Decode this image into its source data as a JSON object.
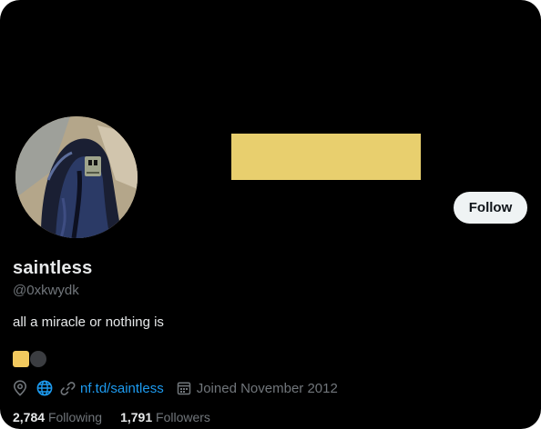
{
  "profile": {
    "display_name": "saintless",
    "handle": "@0xkwydk",
    "bio": "all a miracle or nothing is",
    "follow_label": "Follow",
    "website": "nf.td/saintless",
    "joined": "Joined November 2012",
    "following_count": "2,784",
    "following_label": "Following",
    "followers_count": "1,791",
    "followers_label": "Followers"
  },
  "colors": {
    "background": "#000000",
    "banner_block": "#e8cf6e",
    "follow_button_bg": "#eff3f4",
    "link": "#1d9bf0",
    "secondary_text": "#71767b",
    "primary_text": "#e7e9ea",
    "badge_yellow": "#f2c95e",
    "badge_dark": "#3b3d41"
  },
  "icons": {
    "location": "location-pin-icon",
    "globe": "globe-icon",
    "link": "link-icon",
    "calendar": "calendar-icon"
  }
}
